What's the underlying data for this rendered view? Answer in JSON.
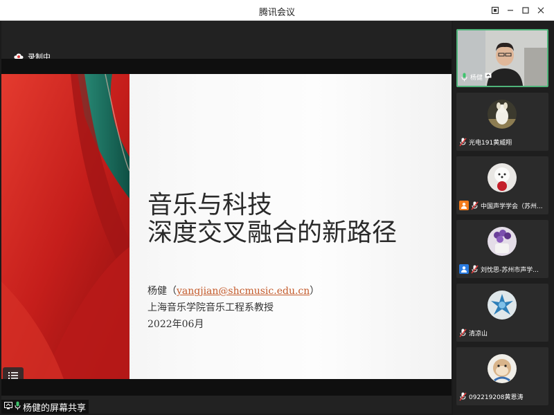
{
  "window": {
    "title": "腾讯会议"
  },
  "recording": {
    "label": "录制中"
  },
  "slide": {
    "title_line1": "音乐与科技",
    "title_line2": "深度交叉融合的新路径",
    "author_name": "杨健（",
    "author_email": "yangjian@shcmusic.edu.cn",
    "author_close": "）",
    "affiliation": "上海音乐学院音乐工程系教授",
    "date": "2022年06月",
    "menu_icon": "list-icon"
  },
  "share": {
    "label": "杨健的屏幕共享"
  },
  "participants": [
    {
      "name": "杨健",
      "video": true,
      "active": true,
      "badge": ""
    },
    {
      "name": "光电191黄威翔",
      "video": false,
      "badge": ""
    },
    {
      "name": "中国声学学会（苏州...",
      "video": false,
      "badge": "orange"
    },
    {
      "name": "刘忱思-苏州市声学...",
      "video": false,
      "badge": "blue"
    },
    {
      "name": "清凉山",
      "video": false,
      "badge": ""
    },
    {
      "name": "092219208黄恩涛",
      "video": false,
      "badge": ""
    }
  ],
  "colors": {
    "accent": "#4fb47a",
    "mic_muted": "#e03c3c",
    "slide_red": "#c0201e"
  }
}
